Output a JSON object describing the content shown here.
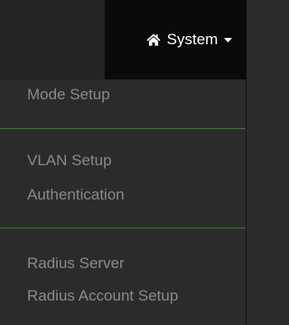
{
  "navbar": {
    "menu_label": "System",
    "home_icon": "home-icon",
    "caret_icon": "caret-down-icon",
    "colors": {
      "background": "#232323",
      "active_background": "#0a0a0a",
      "label": "#ffffff"
    }
  },
  "dropdown": {
    "items": [
      {
        "label": "Mode Setup"
      },
      {
        "label": "VLAN Setup"
      },
      {
        "label": "Authentication"
      },
      {
        "label": "Radius Server"
      },
      {
        "label": "Radius Account Setup"
      }
    ],
    "colors": {
      "background": "#2b2b2b",
      "item_text": "#8a8a8a",
      "divider": "#2f7a2f"
    }
  }
}
